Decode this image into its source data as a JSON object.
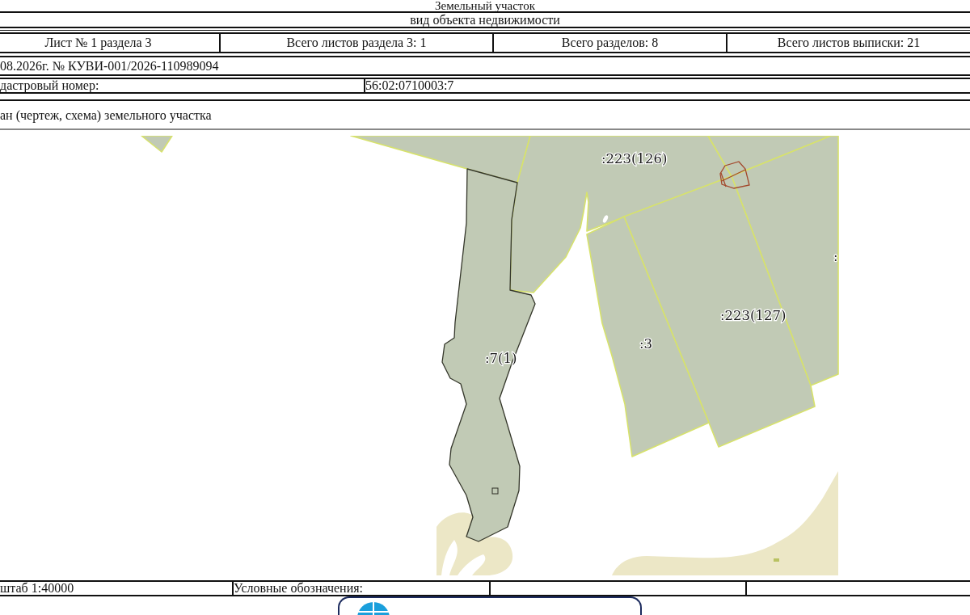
{
  "header": {
    "title": "Земельный участок",
    "subtitle": "вид объекта недвижимости"
  },
  "sheet_info": [
    "Лист № 1 раздела 3",
    "Всего листов раздела 3: 1",
    "Всего разделов: 8",
    "Всего листов выписки: 21"
  ],
  "extract_number": "08.2026г. № КУВИ-001/2026-110989094",
  "cadastral": {
    "label": "дастровый номер:",
    "value": "56:02:0710003:7"
  },
  "plan_title": "ан (чертеж, схема) земельного участка",
  "map": {
    "parcel_labels": [
      ":223(126)",
      ":223(127)",
      ":3",
      ":7(1)",
      ":"
    ]
  },
  "legend_row": {
    "scale": "штаб 1:40000",
    "legend_label": "Условные обозначения:"
  }
}
